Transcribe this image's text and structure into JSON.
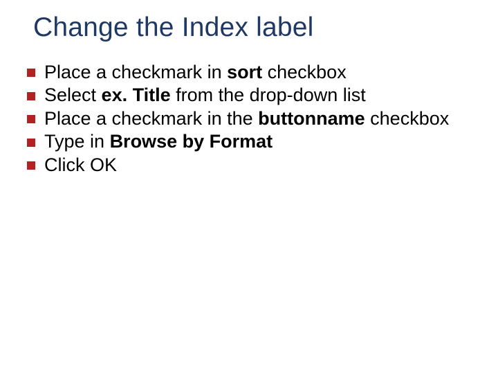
{
  "title": "Change the Index label",
  "bullets": [
    {
      "pre": "Place a checkmark in ",
      "bold": "sort",
      "post": " checkbox"
    },
    {
      "pre": "Select ",
      "bold": "ex. Title",
      "post": " from the drop-down list"
    },
    {
      "pre": "Place a checkmark in the ",
      "bold": "buttonname",
      "post": " checkbox"
    },
    {
      "pre": "Type in ",
      "bold": "Browse by Format",
      "post": ""
    },
    {
      "pre": "Click OK",
      "bold": "",
      "post": ""
    }
  ]
}
